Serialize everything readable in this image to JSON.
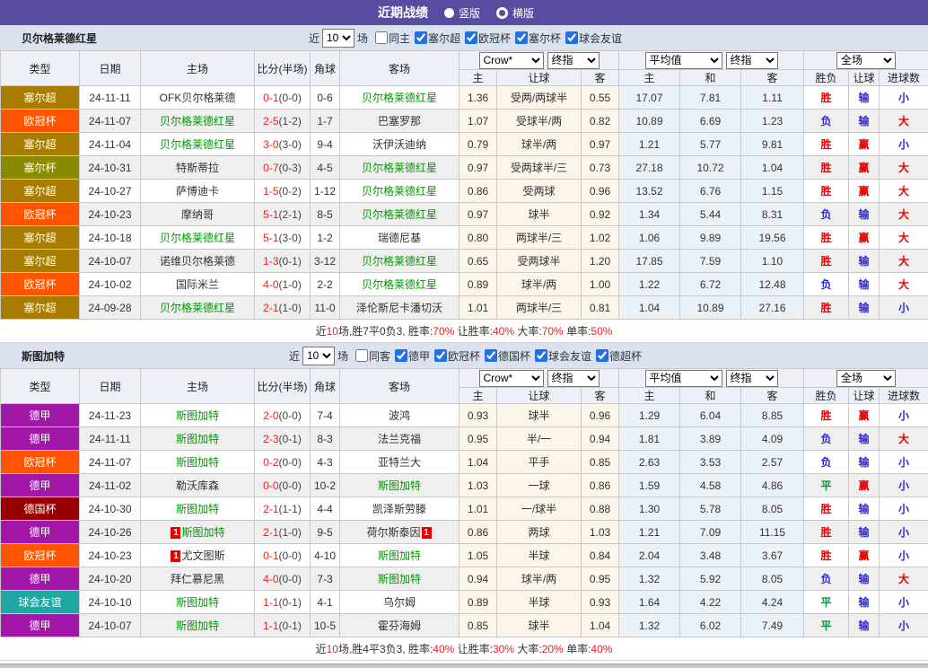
{
  "topbar": {
    "title": "近期战绩",
    "radios": [
      {
        "label": "竖版",
        "selected": true
      },
      {
        "label": "横版",
        "selected": false
      }
    ]
  },
  "table_header": {
    "left_cols": [
      "类型",
      "日期",
      "主场",
      "比分(半场)",
      "角球",
      "客场"
    ],
    "odds_selects": [
      "Crow*",
      "终指"
    ],
    "odds_cols": [
      "主",
      "让球",
      "客"
    ],
    "avg_selects": [
      "平均值",
      "终指"
    ],
    "avg_cols": [
      "主",
      "和",
      "客"
    ],
    "result_select": "全场",
    "result_cols": [
      "胜负",
      "让球",
      "进球数"
    ]
  },
  "league_colors": {
    "塞尔超": "#A87C00",
    "欧冠杯": "#FF5500",
    "塞尔杯": "#8A8A00",
    "德甲": "#A118A9",
    "德国杯": "#980000",
    "球会友谊": "#1FA8A2"
  },
  "result_colors": {
    "胜": "#E60000",
    "负": "#2A2AD4",
    "平": "#009933",
    "赢": "#E60000",
    "输": "#2A2AD4",
    "大": "#E60000",
    "小": "#2A2AD4"
  },
  "sections": [
    {
      "team": "贝尔格莱德红星",
      "filter": {
        "prefix": "近",
        "count": "10",
        "suffix": "场",
        "same": "同主",
        "leagues": [
          "塞尔超",
          "欧冠杯",
          "塞尔杯",
          "球会友谊"
        ]
      },
      "rows": [
        {
          "league": "塞尔超",
          "date": "24-11-11",
          "home": "OFK贝尔格莱德",
          "score": "0-1",
          "half": "(0-0)",
          "corners": "0-6",
          "away": "贝尔格莱德红星",
          "away_focal": true,
          "odds": [
            "1.36",
            "受两/两球半",
            "0.55"
          ],
          "avg": [
            "17.07",
            "7.81",
            "1.11"
          ],
          "results": [
            "胜",
            "输",
            "小"
          ]
        },
        {
          "league": "欧冠杯",
          "date": "24-11-07",
          "home": "贝尔格莱德红星",
          "home_focal": true,
          "score": "2-5",
          "half": "(1-2)",
          "corners": "1-7",
          "away": "巴塞罗那",
          "odds": [
            "1.07",
            "受球半/两",
            "0.82"
          ],
          "avg": [
            "10.89",
            "6.69",
            "1.23"
          ],
          "results": [
            "负",
            "输",
            "大"
          ]
        },
        {
          "league": "塞尔超",
          "date": "24-11-04",
          "home": "贝尔格莱德红星",
          "home_focal": true,
          "score": "3-0",
          "half": "(3-0)",
          "corners": "9-4",
          "away": "沃伊沃迪纳",
          "odds": [
            "0.79",
            "球半/两",
            "0.97"
          ],
          "avg": [
            "1.21",
            "5.77",
            "9.81"
          ],
          "results": [
            "胜",
            "赢",
            "小"
          ]
        },
        {
          "league": "塞尔杯",
          "date": "24-10-31",
          "home": "特斯蒂拉",
          "score": "0-7",
          "half": "(0-3)",
          "corners": "4-5",
          "away": "贝尔格莱德红星",
          "away_focal": true,
          "odds": [
            "0.97",
            "受两球半/三",
            "0.73"
          ],
          "avg": [
            "27.18",
            "10.72",
            "1.04"
          ],
          "results": [
            "胜",
            "赢",
            "大"
          ]
        },
        {
          "league": "塞尔超",
          "date": "24-10-27",
          "home": "萨博迪卡",
          "score": "1-5",
          "half": "(0-2)",
          "corners": "1-12",
          "away": "贝尔格莱德红星",
          "away_focal": true,
          "odds": [
            "0.86",
            "受两球",
            "0.96"
          ],
          "avg": [
            "13.52",
            "6.76",
            "1.15"
          ],
          "results": [
            "胜",
            "赢",
            "大"
          ]
        },
        {
          "league": "欧冠杯",
          "date": "24-10-23",
          "home": "摩纳哥",
          "score": "5-1",
          "half": "(2-1)",
          "corners": "8-5",
          "away": "贝尔格莱德红星",
          "away_focal": true,
          "odds": [
            "0.97",
            "球半",
            "0.92"
          ],
          "avg": [
            "1.34",
            "5.44",
            "8.31"
          ],
          "results": [
            "负",
            "输",
            "大"
          ]
        },
        {
          "league": "塞尔超",
          "date": "24-10-18",
          "home": "贝尔格莱德红星",
          "home_focal": true,
          "score": "5-1",
          "half": "(3-0)",
          "corners": "1-2",
          "away": "瑞德尼基",
          "odds": [
            "0.80",
            "两球半/三",
            "1.02"
          ],
          "avg": [
            "1.06",
            "9.89",
            "19.56"
          ],
          "results": [
            "胜",
            "赢",
            "大"
          ]
        },
        {
          "league": "塞尔超",
          "date": "24-10-07",
          "home": "诺维贝尔格莱德",
          "score": "1-3",
          "half": "(0-1)",
          "corners": "3-12",
          "away": "贝尔格莱德红星",
          "away_focal": true,
          "odds": [
            "0.65",
            "受两球半",
            "1.20"
          ],
          "avg": [
            "17.85",
            "7.59",
            "1.10"
          ],
          "results": [
            "胜",
            "输",
            "大"
          ]
        },
        {
          "league": "欧冠杯",
          "date": "24-10-02",
          "home": "国际米兰",
          "score": "4-0",
          "half": "(1-0)",
          "corners": "2-2",
          "away": "贝尔格莱德红星",
          "away_focal": true,
          "odds": [
            "0.89",
            "球半/两",
            "1.00"
          ],
          "avg": [
            "1.22",
            "6.72",
            "12.48"
          ],
          "results": [
            "负",
            "输",
            "大"
          ]
        },
        {
          "league": "塞尔超",
          "date": "24-09-28",
          "home": "贝尔格莱德红星",
          "home_focal": true,
          "score": "2-1",
          "half": "(1-0)",
          "corners": "11-0",
          "away": "泽伦斯尼卡潘切沃",
          "odds": [
            "1.01",
            "两球半/三",
            "0.81"
          ],
          "avg": [
            "1.04",
            "10.89",
            "27.16"
          ],
          "results": [
            "胜",
            "输",
            "小"
          ]
        }
      ],
      "summary": [
        {
          "text": "近",
          "red": false
        },
        {
          "text": "10",
          "red": true
        },
        {
          "text": "场,胜7平0负3, 胜率:",
          "red": false
        },
        {
          "text": "70%",
          "red": true
        },
        {
          "text": " 让胜率:",
          "red": false
        },
        {
          "text": "40%",
          "red": true
        },
        {
          "text": " 大率:",
          "red": false
        },
        {
          "text": "70%",
          "red": true
        },
        {
          "text": " 单率:",
          "red": false
        },
        {
          "text": "50%",
          "red": true
        }
      ]
    },
    {
      "team": "斯图加特",
      "filter": {
        "prefix": "近",
        "count": "10",
        "suffix": "场",
        "same": "同客",
        "leagues": [
          "德甲",
          "欧冠杯",
          "德国杯",
          "球会友谊",
          "德超杯"
        ]
      },
      "rows": [
        {
          "league": "德甲",
          "date": "24-11-23",
          "home": "斯图加特",
          "home_focal": true,
          "score": "2-0",
          "half": "(0-0)",
          "corners": "7-4",
          "away": "波鸿",
          "odds": [
            "0.93",
            "球半",
            "0.96"
          ],
          "avg": [
            "1.29",
            "6.04",
            "8.85"
          ],
          "results": [
            "胜",
            "赢",
            "小"
          ]
        },
        {
          "league": "德甲",
          "date": "24-11-11",
          "home": "斯图加特",
          "home_focal": true,
          "score": "2-3",
          "half": "(0-1)",
          "corners": "8-3",
          "away": "法兰克福",
          "odds": [
            "0.95",
            "半/一",
            "0.94"
          ],
          "avg": [
            "1.81",
            "3.89",
            "4.09"
          ],
          "results": [
            "负",
            "输",
            "大"
          ]
        },
        {
          "league": "欧冠杯",
          "date": "24-11-07",
          "home": "斯图加特",
          "home_focal": true,
          "score": "0-2",
          "half": "(0-0)",
          "corners": "4-3",
          "away": "亚特兰大",
          "odds": [
            "1.04",
            "平手",
            "0.85"
          ],
          "avg": [
            "2.63",
            "3.53",
            "2.57"
          ],
          "results": [
            "负",
            "输",
            "小"
          ]
        },
        {
          "league": "德甲",
          "date": "24-11-02",
          "home": "勒沃库森",
          "score": "0-0",
          "half": "(0-0)",
          "corners": "10-2",
          "away": "斯图加特",
          "away_focal": true,
          "odds": [
            "1.03",
            "一球",
            "0.86"
          ],
          "avg": [
            "1.59",
            "4.58",
            "4.86"
          ],
          "results": [
            "平",
            "赢",
            "小"
          ]
        },
        {
          "league": "德国杯",
          "date": "24-10-30",
          "home": "斯图加特",
          "home_focal": true,
          "score": "2-1",
          "half": "(1-1)",
          "corners": "4-4",
          "away": "凯泽斯劳滕",
          "odds": [
            "1.01",
            "一/球半",
            "0.88"
          ],
          "avg": [
            "1.30",
            "5.78",
            "8.05"
          ],
          "results": [
            "胜",
            "输",
            "小"
          ]
        },
        {
          "league": "德甲",
          "date": "24-10-26",
          "home": "斯图加特",
          "home_focal": true,
          "home_card": "1",
          "score": "2-1",
          "half": "(1-0)",
          "corners": "9-5",
          "away": "荷尔斯泰因",
          "away_card": "1",
          "odds": [
            "0.86",
            "两球",
            "1.03"
          ],
          "avg": [
            "1.21",
            "7.09",
            "11.15"
          ],
          "results": [
            "胜",
            "输",
            "小"
          ]
        },
        {
          "league": "欧冠杯",
          "date": "24-10-23",
          "home": "尤文图斯",
          "home_card": "1",
          "score": "0-1",
          "half": "(0-0)",
          "corners": "4-10",
          "away": "斯图加特",
          "away_focal": true,
          "odds": [
            "1.05",
            "半球",
            "0.84"
          ],
          "avg": [
            "2.04",
            "3.48",
            "3.67"
          ],
          "results": [
            "胜",
            "赢",
            "小"
          ]
        },
        {
          "league": "德甲",
          "date": "24-10-20",
          "home": "拜仁慕尼黑",
          "score": "4-0",
          "half": "(0-0)",
          "corners": "7-3",
          "away": "斯图加特",
          "away_focal": true,
          "odds": [
            "0.94",
            "球半/两",
            "0.95"
          ],
          "avg": [
            "1.32",
            "5.92",
            "8.05"
          ],
          "results": [
            "负",
            "输",
            "大"
          ]
        },
        {
          "league": "球会友谊",
          "date": "24-10-10",
          "home": "斯图加特",
          "home_focal": true,
          "score": "1-1",
          "half": "(0-1)",
          "corners": "4-1",
          "away": "乌尔姆",
          "odds": [
            "0.89",
            "半球",
            "0.93"
          ],
          "avg": [
            "1.64",
            "4.22",
            "4.24"
          ],
          "results": [
            "平",
            "输",
            "小"
          ]
        },
        {
          "league": "德甲",
          "date": "24-10-07",
          "home": "斯图加特",
          "home_focal": true,
          "score": "1-1",
          "half": "(0-1)",
          "corners": "10-5",
          "away": "霍芬海姆",
          "odds": [
            "0.85",
            "球半",
            "1.04"
          ],
          "avg": [
            "1.32",
            "6.02",
            "7.49"
          ],
          "results": [
            "平",
            "输",
            "小"
          ]
        }
      ],
      "summary": [
        {
          "text": "近",
          "red": false
        },
        {
          "text": "10",
          "red": true
        },
        {
          "text": "场,胜4平3负3, 胜率:",
          "red": false
        },
        {
          "text": "40%",
          "red": true
        },
        {
          "text": " 让胜率:",
          "red": false
        },
        {
          "text": "30%",
          "red": true
        },
        {
          "text": " 大率:",
          "red": false
        },
        {
          "text": "20%",
          "red": true
        },
        {
          "text": " 单率:",
          "red": false
        },
        {
          "text": "40%",
          "red": true
        }
      ]
    }
  ]
}
